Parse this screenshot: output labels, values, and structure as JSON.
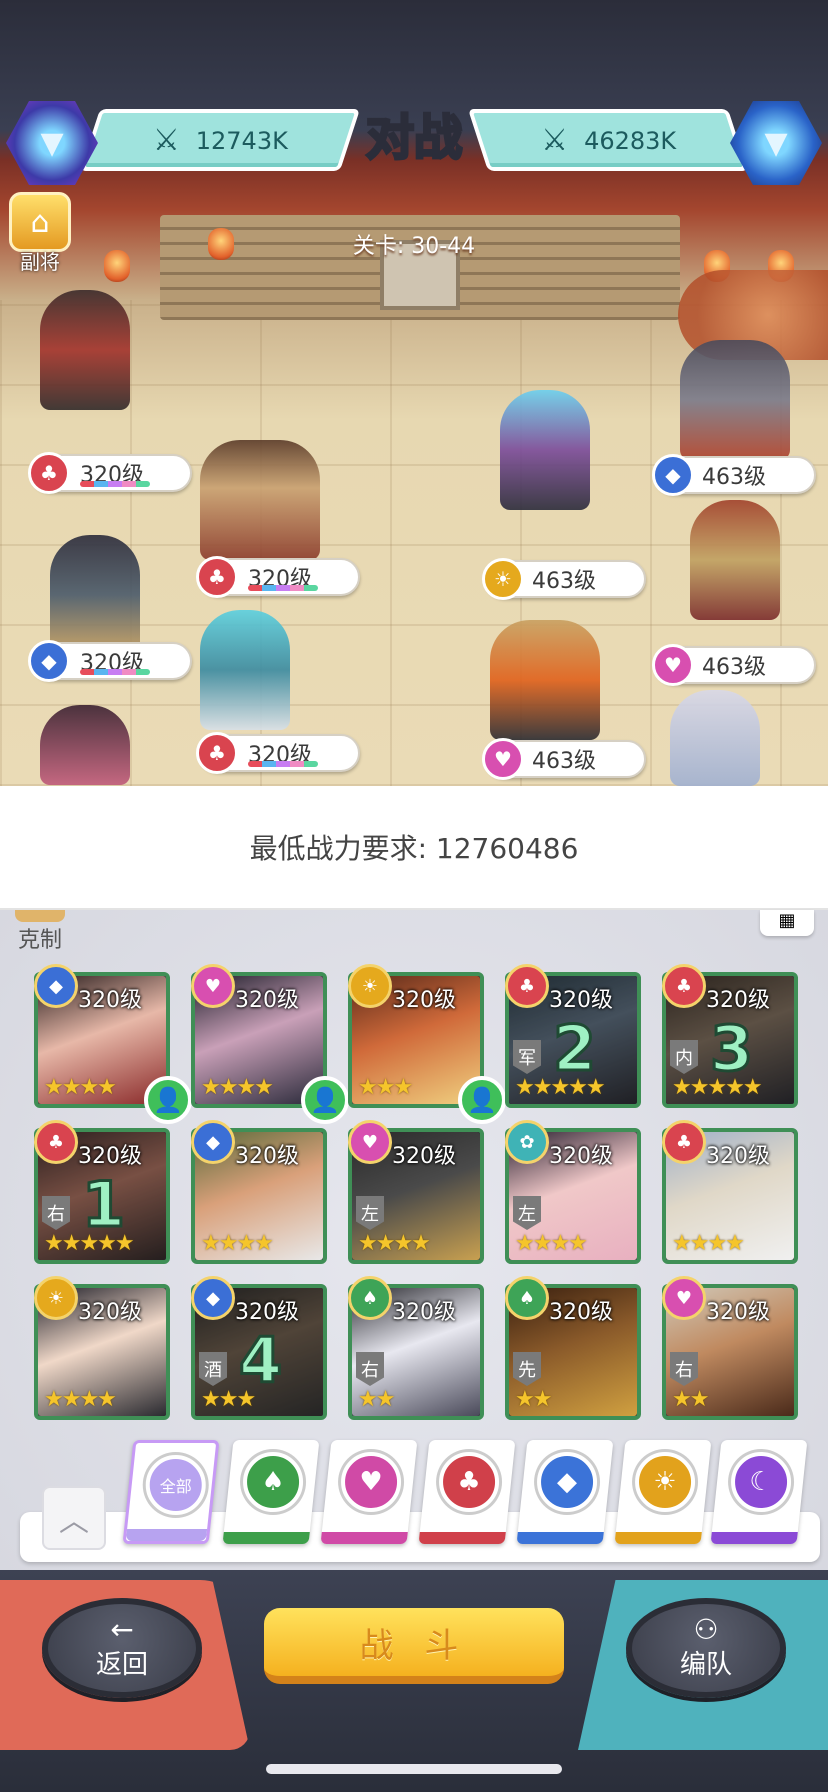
{
  "battle": {
    "title": "对战",
    "left_power": "12743K",
    "right_power": "46283K",
    "stage_label": "关卡: 30-44",
    "side_button_label": "副将"
  },
  "left_team": [
    {
      "level": "320级",
      "faction": "red"
    },
    {
      "level": "320级",
      "faction": "red"
    },
    {
      "level": "320级",
      "faction": "blue"
    },
    {
      "level": "320级",
      "faction": "red"
    }
  ],
  "right_team": [
    {
      "level": "463级",
      "faction": "blue"
    },
    {
      "level": "463级",
      "faction": "yellow"
    },
    {
      "level": "463级",
      "faction": "pink"
    },
    {
      "level": "463级",
      "faction": "pink"
    }
  ],
  "requirement": "最低战力要求: 12760486",
  "roster": {
    "counter_label": "克制",
    "grid_icon": "grid-icon",
    "heroes": [
      {
        "level": "320级",
        "faction": "blue",
        "stars": "★★★★",
        "friend": true
      },
      {
        "level": "320级",
        "faction": "pink",
        "stars": "★★★★",
        "friend": true
      },
      {
        "level": "320级",
        "faction": "yellow",
        "stars": "★★★",
        "friend": true
      },
      {
        "level": "320级",
        "faction": "red",
        "stars": "★★★★★",
        "pos": "军",
        "slot": "2"
      },
      {
        "level": "320级",
        "faction": "red",
        "stars": "★★★★★",
        "pos": "内",
        "slot": "3"
      },
      {
        "level": "320级",
        "faction": "red",
        "stars": "★★★★★",
        "pos": "右",
        "slot": "1"
      },
      {
        "level": "320级",
        "faction": "blue",
        "stars": "★★★★"
      },
      {
        "level": "320级",
        "faction": "pink",
        "stars": "★★★★",
        "pos": "左"
      },
      {
        "level": "320级",
        "faction": "teal",
        "stars": "★★★★",
        "pos": "左"
      },
      {
        "level": "320级",
        "faction": "red",
        "stars": "★★★★"
      },
      {
        "level": "320级",
        "faction": "yellow",
        "stars": "★★★★"
      },
      {
        "level": "320级",
        "faction": "blue",
        "stars": "★★★",
        "pos": "酒",
        "slot": "4"
      },
      {
        "level": "320级",
        "faction": "green",
        "stars": "★★",
        "pos": "右"
      },
      {
        "level": "320级",
        "faction": "green",
        "stars": "★★",
        "pos": "先"
      },
      {
        "level": "320级",
        "faction": "pink",
        "stars": "★★",
        "pos": "右"
      }
    ]
  },
  "filters": [
    {
      "name": "all",
      "label": "全部",
      "color": "#b7a3f0"
    },
    {
      "name": "green",
      "label": "♠",
      "color": "#3d9f4a"
    },
    {
      "name": "pink",
      "label": "♥",
      "color": "#d04aa6"
    },
    {
      "name": "red",
      "label": "♣",
      "color": "#d0404a"
    },
    {
      "name": "blue",
      "label": "◆",
      "color": "#3b73d8"
    },
    {
      "name": "yellow",
      "label": "☀",
      "color": "#e2a21c"
    },
    {
      "name": "purple",
      "label": "☾",
      "color": "#8b4ad6"
    }
  ],
  "controls": {
    "back_label": "返回",
    "fight_label": "战 斗",
    "team_label": "编队"
  },
  "colors": {
    "red": "#d9444f",
    "blue": "#3b6fd6",
    "pink": "#d84fb0",
    "yellow": "#e5a91d",
    "green": "#3ea457",
    "teal": "#3fb3b6"
  }
}
